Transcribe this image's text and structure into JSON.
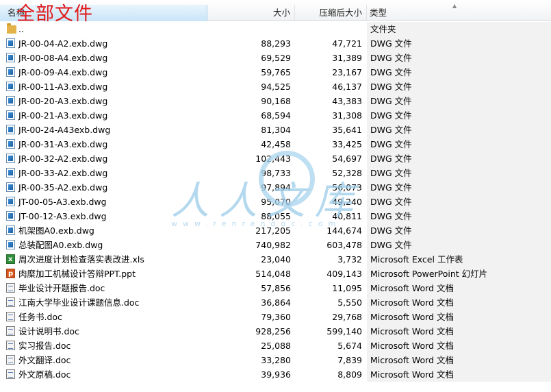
{
  "header": {
    "columns": {
      "name": "名称",
      "size": "大小",
      "compressed": "压缩后大小",
      "type": "类型"
    },
    "path_label": "全部文件"
  },
  "files": [
    {
      "icon": "folder-icon",
      "kind": "folder",
      "name": "..",
      "size": "",
      "compressed": "",
      "type": "文件夹"
    },
    {
      "icon": "dwg-file-icon",
      "kind": "dwg",
      "name": "JR-00-04-A2.exb.dwg",
      "size": "88,293",
      "compressed": "47,721",
      "type": "DWG 文件"
    },
    {
      "icon": "dwg-file-icon",
      "kind": "dwg",
      "name": "JR-00-08-A4.exb.dwg",
      "size": "69,529",
      "compressed": "31,389",
      "type": "DWG 文件"
    },
    {
      "icon": "dwg-file-icon",
      "kind": "dwg",
      "name": "JR-00-09-A4.exb.dwg",
      "size": "59,765",
      "compressed": "23,167",
      "type": "DWG 文件"
    },
    {
      "icon": "dwg-file-icon",
      "kind": "dwg",
      "name": "JR-00-11-A3.exb.dwg",
      "size": "94,525",
      "compressed": "46,137",
      "type": "DWG 文件"
    },
    {
      "icon": "dwg-file-icon",
      "kind": "dwg",
      "name": "JR-00-20-A3.exb.dwg",
      "size": "90,168",
      "compressed": "43,383",
      "type": "DWG 文件"
    },
    {
      "icon": "dwg-file-icon",
      "kind": "dwg",
      "name": "JR-00-21-A3.exb.dwg",
      "size": "68,594",
      "compressed": "31,308",
      "type": "DWG 文件"
    },
    {
      "icon": "dwg-file-icon",
      "kind": "dwg",
      "name": "JR-00-24-A43exb.dwg",
      "size": "81,304",
      "compressed": "35,641",
      "type": "DWG 文件"
    },
    {
      "icon": "dwg-file-icon",
      "kind": "dwg",
      "name": "JR-00-31-A3.exb.dwg",
      "size": "42,458",
      "compressed": "33,425",
      "type": "DWG 文件"
    },
    {
      "icon": "dwg-file-icon",
      "kind": "dwg",
      "name": "JR-00-32-A2.exb.dwg",
      "size": "102,443",
      "compressed": "54,697",
      "type": "DWG 文件"
    },
    {
      "icon": "dwg-file-icon",
      "kind": "dwg",
      "name": "JR-00-33-A2.exb.dwg",
      "size": "98,733",
      "compressed": "52,328",
      "type": "DWG 文件"
    },
    {
      "icon": "dwg-file-icon",
      "kind": "dwg",
      "name": "JR-00-35-A2.exb.dwg",
      "size": "97,894",
      "compressed": "56,073",
      "type": "DWG 文件"
    },
    {
      "icon": "dwg-file-icon",
      "kind": "dwg",
      "name": "JT-00-05-A3.exb.dwg",
      "size": "95,070",
      "compressed": "49,240",
      "type": "DWG 文件"
    },
    {
      "icon": "dwg-file-icon",
      "kind": "dwg",
      "name": "JT-00-12-A3.exb.dwg",
      "size": "88,055",
      "compressed": "40,811",
      "type": "DWG 文件"
    },
    {
      "icon": "dwg-file-icon",
      "kind": "dwg",
      "name": "机架图A0.exb.dwg",
      "size": "217,205",
      "compressed": "144,674",
      "type": "DWG 文件"
    },
    {
      "icon": "dwg-file-icon",
      "kind": "dwg",
      "name": "总装配图A0.exb.dwg",
      "size": "740,982",
      "compressed": "603,478",
      "type": "DWG 文件"
    },
    {
      "icon": "excel-file-icon",
      "kind": "xls",
      "name": "周次进度计划检查落实表改进.xls",
      "size": "23,040",
      "compressed": "3,732",
      "type": "Microsoft Excel 工作表"
    },
    {
      "icon": "powerpoint-file-icon",
      "kind": "ppt",
      "name": "肉糜加工机械设计答辩PPT.ppt",
      "size": "514,048",
      "compressed": "409,143",
      "type": "Microsoft PowerPoint 幻灯片"
    },
    {
      "icon": "word-file-icon",
      "kind": "doc",
      "name": "毕业设计开题报告.doc",
      "size": "57,856",
      "compressed": "11,095",
      "type": "Microsoft Word 文档"
    },
    {
      "icon": "word-file-icon",
      "kind": "doc",
      "name": "江南大学毕业设计课题信息.doc",
      "size": "36,864",
      "compressed": "5,550",
      "type": "Microsoft Word 文档"
    },
    {
      "icon": "word-file-icon",
      "kind": "doc",
      "name": "任务书.doc",
      "size": "79,360",
      "compressed": "29,768",
      "type": "Microsoft Word 文档"
    },
    {
      "icon": "word-file-icon",
      "kind": "doc",
      "name": "设计说明书.doc",
      "size": "928,256",
      "compressed": "599,140",
      "type": "Microsoft Word 文档"
    },
    {
      "icon": "word-file-icon",
      "kind": "doc",
      "name": "实习报告.doc",
      "size": "25,088",
      "compressed": "5,674",
      "type": "Microsoft Word 文档"
    },
    {
      "icon": "word-file-icon",
      "kind": "doc",
      "name": "外文翻译.doc",
      "size": "33,280",
      "compressed": "7,839",
      "type": "Microsoft Word 文档"
    },
    {
      "icon": "word-file-icon",
      "kind": "doc",
      "name": "外文原稿.doc",
      "size": "39,936",
      "compressed": "8,809",
      "type": "Microsoft Word 文档"
    }
  ],
  "watermark": {
    "text": "人人文库",
    "url": "www.renrendoc.com"
  }
}
